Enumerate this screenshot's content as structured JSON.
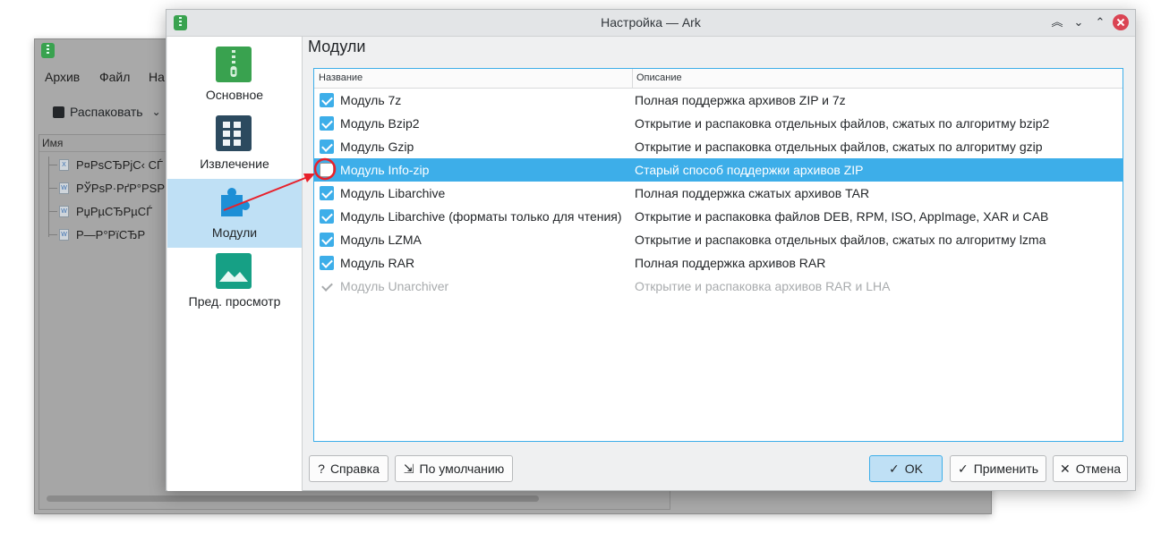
{
  "background_window": {
    "menu": [
      "Архив",
      "Файл",
      "На"
    ],
    "extract_label": "Распаковать",
    "column_name": "Имя",
    "files": [
      "Р¤РѕСЂРјС‹ СЃ",
      "РЎРѕР·РґР°РЅР",
      "РџРµСЂРµСЃ",
      "Р—Р°РїСЂР"
    ]
  },
  "dialog": {
    "title": "Настройка — Ark",
    "sidebar": [
      {
        "label": "Основное",
        "icon": "archive-zipper-icon",
        "active": false
      },
      {
        "label": "Извлечение",
        "icon": "extract-grid-icon",
        "active": false
      },
      {
        "label": "Модули",
        "icon": "puzzle-plugin-icon",
        "active": true
      },
      {
        "label": "Пред. просмотр",
        "icon": "image-preview-icon",
        "active": false
      }
    ],
    "page_title": "Модули",
    "table": {
      "col_name": "Название",
      "col_desc": "Описание",
      "rows": [
        {
          "name": "Модуль 7z",
          "desc": "Полная поддержка архивов ZIP и 7z",
          "checked": true,
          "selected": false,
          "disabled": false
        },
        {
          "name": "Модуль Bzip2",
          "desc": "Открытие и распаковка отдельных файлов, сжатых по алгоритму bzip2",
          "checked": true,
          "selected": false,
          "disabled": false
        },
        {
          "name": "Модуль Gzip",
          "desc": "Открытие и распаковка отдельных файлов, сжатых по алгоритму gzip",
          "checked": true,
          "selected": false,
          "disabled": false
        },
        {
          "name": "Модуль Info-zip",
          "desc": "Старый способ поддержки архивов ZIP",
          "checked": false,
          "selected": true,
          "disabled": false
        },
        {
          "name": "Модуль Libarchive",
          "desc": "Полная поддержка сжатых архивов TAR",
          "checked": true,
          "selected": false,
          "disabled": false
        },
        {
          "name": "Модуль Libarchive (форматы только для чтения)",
          "desc": "Открытие и распаковка файлов DEB, RPM, ISO, AppImage, XAR и CAB",
          "checked": true,
          "selected": false,
          "disabled": false
        },
        {
          "name": "Модуль LZMA",
          "desc": "Открытие и распаковка отдельных файлов, сжатых по алгоритму lzma",
          "checked": true,
          "selected": false,
          "disabled": false
        },
        {
          "name": "Модуль RAR",
          "desc": "Полная поддержка архивов RAR",
          "checked": true,
          "selected": false,
          "disabled": false
        },
        {
          "name": "Модуль Unarchiver",
          "desc": "Открытие и распаковка архивов RAR и LHA",
          "checked": true,
          "selected": false,
          "disabled": true
        }
      ]
    },
    "buttons": {
      "help": "Справка",
      "defaults": "По умолчанию",
      "ok": "OK",
      "apply": "Применить",
      "cancel": "Отмена"
    }
  },
  "colors": {
    "accent": "#3daee9",
    "selection_bg": "#3daee9",
    "sidebar_active": "#bfe0f5",
    "annotation_red": "#e8202a",
    "close_button": "#da4453"
  }
}
